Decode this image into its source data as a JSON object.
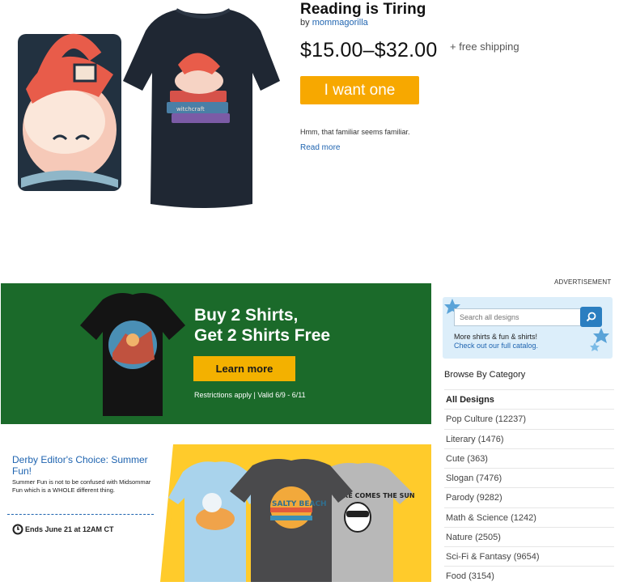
{
  "product": {
    "title": "Reading is Tiring",
    "by_prefix": "by",
    "artist": "mommagorilla",
    "price": "$15.00–$32.00",
    "shipping": "+ free shipping",
    "cta": "I want one",
    "description": "Hmm, that familiar seems familiar.",
    "read_more": "Read more",
    "book_text": "witchcraft"
  },
  "promo": {
    "headline_line1": "Buy 2 Shirts,",
    "headline_line2": "Get 2 Shirts Free",
    "button": "Learn more",
    "terms": "Restrictions apply | Valid 6/9 - 6/11"
  },
  "derby": {
    "title": "Derby Editor's Choice: Summer Fun!",
    "description": "Summer Fun is not to be confused with Midsommar Fun which is a WHOLE different thing.",
    "ends": "Ends June 21 at 12AM CT",
    "shirt_text_1": "SALTY BEACH",
    "shirt_text_2": "HERE COMES THE SUN"
  },
  "sidebar": {
    "ad_label": "ADVERTISEMENT",
    "search_placeholder": "Search all designs",
    "catalog_line": "More shirts & fun & shirts!",
    "catalog_link": "Check out our full catalog.",
    "browse_heading": "Browse By Category",
    "categories": [
      {
        "label": "All Designs",
        "active": true
      },
      {
        "label": "Pop Culture (12237)"
      },
      {
        "label": "Literary (1476)"
      },
      {
        "label": "Cute (363)"
      },
      {
        "label": "Slogan (7476)"
      },
      {
        "label": "Parody (9282)"
      },
      {
        "label": "Math & Science (1242)"
      },
      {
        "label": "Nature (2505)"
      },
      {
        "label": "Sci-Fi & Fantasy (9654)"
      },
      {
        "label": "Food (3154)"
      }
    ]
  },
  "colors": {
    "link": "#1f64b0",
    "cta": "#f7a800",
    "promo_bg": "#1b6a2a",
    "derby_bg": "#ffcb2b"
  }
}
